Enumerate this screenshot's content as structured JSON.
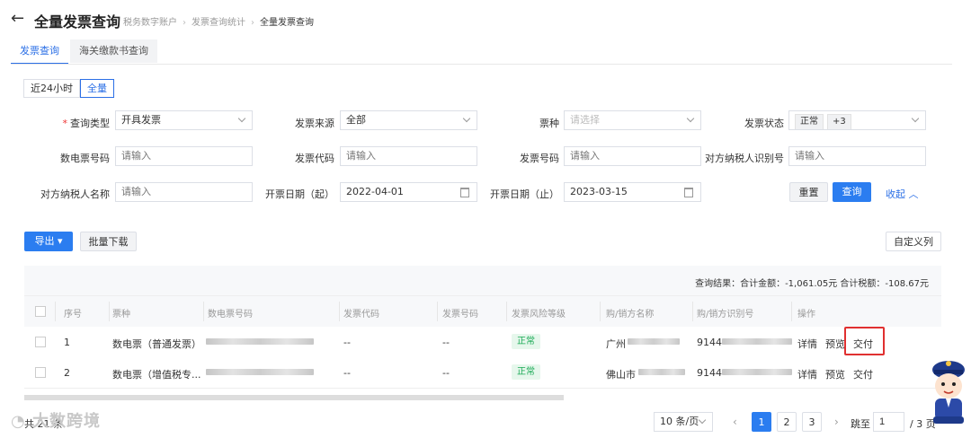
{
  "header": {
    "back_icon": "arrow-left-icon",
    "title": "全量发票查询",
    "breadcrumb": [
      "税务数字账户",
      "发票查询统计",
      "全量发票查询"
    ]
  },
  "tabs": [
    {
      "label": "发票查询",
      "active": true
    },
    {
      "label": "海关缴款书查询",
      "active": false
    }
  ],
  "time_range": {
    "options": [
      "近24小时",
      "全量"
    ],
    "selected": "全量"
  },
  "form": {
    "query_type": {
      "label": "查询类型",
      "value": "开具发票",
      "required": true
    },
    "source": {
      "label": "发票来源",
      "value": "全部"
    },
    "ticket_type": {
      "label": "票种",
      "placeholder": "请选择"
    },
    "status": {
      "label": "发票状态",
      "tags": [
        "正常",
        "+3"
      ]
    },
    "digital_no": {
      "label": "数电票号码",
      "placeholder": "请输入"
    },
    "invoice_code": {
      "label": "发票代码",
      "placeholder": "请输入"
    },
    "invoice_no": {
      "label": "发票号码",
      "placeholder": "请输入"
    },
    "counterparty_id": {
      "label": "对方纳税人识别号",
      "placeholder": "请输入"
    },
    "counterparty_name": {
      "label": "对方纳税人名称",
      "placeholder": "请输入"
    },
    "date_start": {
      "label": "开票日期（起）",
      "value": "2022-04-01"
    },
    "date_end": {
      "label": "开票日期（止）",
      "value": "2023-03-15"
    },
    "reset_label": "重置",
    "search_label": "查询",
    "collapse_label": "收起"
  },
  "toolbar": {
    "export_label": "导出",
    "batch_download_label": "批量下载",
    "custom_columns_label": "自定义列"
  },
  "summary": {
    "text": "查询结果：合计金额：-1,061.05元   合计税额：-108.67元"
  },
  "table": {
    "columns": [
      "序号",
      "票种",
      "数电票号码",
      "发票代码",
      "发票号码",
      "发票风险等级",
      "购/销方名称",
      "购/销方识别号",
      "操作"
    ],
    "rows": [
      {
        "index": "1",
        "type": "数电票（普通发票）",
        "code": "--",
        "number": "--",
        "risk": "正常",
        "name": "广州",
        "tax_id": "9144",
        "actions": [
          "详情",
          "预览",
          "交付"
        ]
      },
      {
        "index": "2",
        "type": "数电票（增值税专...",
        "code": "--",
        "number": "--",
        "risk": "正常",
        "name": "佛山市",
        "tax_id": "9144",
        "actions": [
          "详情",
          "预览",
          "交付"
        ]
      }
    ]
  },
  "pagination": {
    "total_prefix": "共 21 条",
    "page_size": "10 条/页",
    "pages": [
      "1",
      "2",
      "3"
    ],
    "current": "1",
    "jump_label": "跳至",
    "jump_value": "1",
    "total_pages": "/ 3 页"
  },
  "watermark": "大数跨境",
  "colors": {
    "primary": "#2b7df0",
    "risk_normal": "#1aaa55",
    "highlight_box": "#e03030"
  }
}
